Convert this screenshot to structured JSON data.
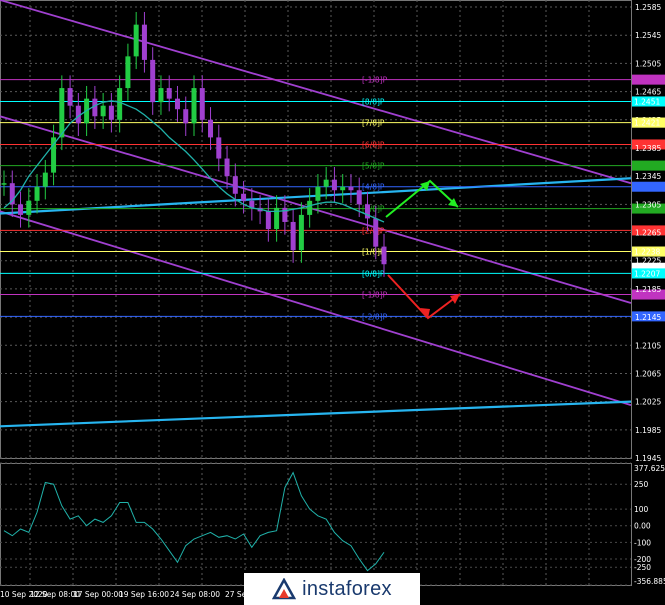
{
  "chart_data": {
    "type": "line",
    "title": "",
    "main_panel": {
      "price_ticks": [
        "1.2585",
        "1.2545",
        "1.2505",
        "1.2465",
        "1.2425",
        "1.2385",
        "1.2345",
        "1.2305",
        "1.2265",
        "1.2225",
        "1.2185",
        "1.2145",
        "1.2105",
        "1.2065",
        "1.2025",
        "1.1985",
        "1.1945"
      ],
      "ylim": [
        1.1945,
        1.2595
      ],
      "price_tags": [
        {
          "value": "1.2451",
          "price": 1.2451,
          "color": "#00ffff"
        },
        {
          "value": "1.2421",
          "price": 1.2421,
          "color": "#ffff66"
        },
        {
          "value": "1.2238",
          "price": 1.2238,
          "color": "#ffff66"
        },
        {
          "value": "1.2215",
          "price": 1.2215,
          "color": "#ffffff"
        },
        {
          "value": "1.2207",
          "price": 1.2207,
          "color": "#00ffff"
        }
      ],
      "murrey_lines": [
        {
          "label": "[-1/8]P",
          "price": 1.2482,
          "color": "#c033c0"
        },
        {
          "label": "[8/8]P",
          "price": 1.2451,
          "color": "#00ffff"
        },
        {
          "label": "[7/8]P",
          "price": 1.2421,
          "color": "#ffff66"
        },
        {
          "label": "[6/8]P",
          "price": 1.239,
          "color": "#ff3333"
        },
        {
          "label": "[5/8]P",
          "price": 1.236,
          "color": "#22aa22"
        },
        {
          "label": "[4/8]P",
          "price": 1.233,
          "color": "#3366ff"
        },
        {
          "label": "[3/8]P",
          "price": 1.2299,
          "color": "#22aa22"
        },
        {
          "label": "[2/8]P",
          "price": 1.2268,
          "color": "#ff3333"
        },
        {
          "label": "[1/8]P",
          "price": 1.2238,
          "color": "#ffff66"
        },
        {
          "label": "[0/8]P",
          "price": 1.2207,
          "color": "#00ffff"
        },
        {
          "label": "[-1/8]P",
          "price": 1.2177,
          "color": "#c033c0"
        },
        {
          "label": "[-2/8]P",
          "price": 1.2146,
          "color": "#3366ff"
        }
      ],
      "close_series": [
        1.2335,
        1.2305,
        1.229,
        1.231,
        1.233,
        1.235,
        1.24,
        1.247,
        1.2445,
        1.242,
        1.2455,
        1.243,
        1.2445,
        1.2425,
        1.247,
        1.2515,
        1.256,
        1.251,
        1.245,
        1.247,
        1.2455,
        1.244,
        1.242,
        1.247,
        1.2425,
        1.24,
        1.237,
        1.2345,
        1.232,
        1.231,
        1.23,
        1.2295,
        1.227,
        1.23,
        1.228,
        1.224,
        1.229,
        1.231,
        1.233,
        1.234,
        1.2325,
        1.233,
        1.2325,
        1.2305,
        1.2285,
        1.2245,
        1.222
      ],
      "ma_series": [
        1.23,
        1.231,
        1.2325,
        1.2345,
        1.236,
        1.2375,
        1.239,
        1.2405,
        1.242,
        1.243,
        1.2438,
        1.2445,
        1.245,
        1.2452,
        1.245,
        1.2445,
        1.244,
        1.2432,
        1.2422,
        1.2412,
        1.24,
        1.239,
        1.238,
        1.2368,
        1.2355,
        1.2342,
        1.233,
        1.232,
        1.2312,
        1.2305,
        1.23,
        1.2298,
        1.2295,
        1.2295,
        1.2296,
        1.2298,
        1.23,
        1.2303,
        1.2306,
        1.2308,
        1.2308,
        1.2305,
        1.23,
        1.2295,
        1.229,
        1.2285,
        1.228
      ]
    },
    "oscillator_panel": {
      "ticks": [
        "377.6254",
        "250",
        "100",
        "0.00",
        "-100",
        "-200",
        "-250",
        "-356.8855"
      ],
      "ylim": [
        -356.8855,
        377.6254
      ],
      "series": [
        -30,
        -60,
        -20,
        -40,
        80,
        260,
        250,
        120,
        40,
        60,
        0,
        40,
        20,
        60,
        140,
        140,
        20,
        20,
        -20,
        -80,
        -150,
        -220,
        -120,
        -80,
        -60,
        -40,
        -70,
        -60,
        -80,
        -50,
        -130,
        -60,
        -40,
        -30,
        230,
        320,
        180,
        100,
        60,
        40,
        -40,
        -90,
        -120,
        -200,
        -270,
        -230,
        -160
      ]
    },
    "x_tick_labels": [
      "10 Sep 2020",
      "12 Sep 08:00",
      "17 Sep 00:00",
      "19 Sep 16:00",
      "24 Sep 08:00",
      "27 Sep"
    ],
    "forecast_arrows": [
      {
        "direction": "up",
        "color": "#22ee22"
      },
      {
        "direction": "down",
        "color": "#ee2222"
      }
    ]
  },
  "branding": {
    "logo_text": "instaforex"
  }
}
